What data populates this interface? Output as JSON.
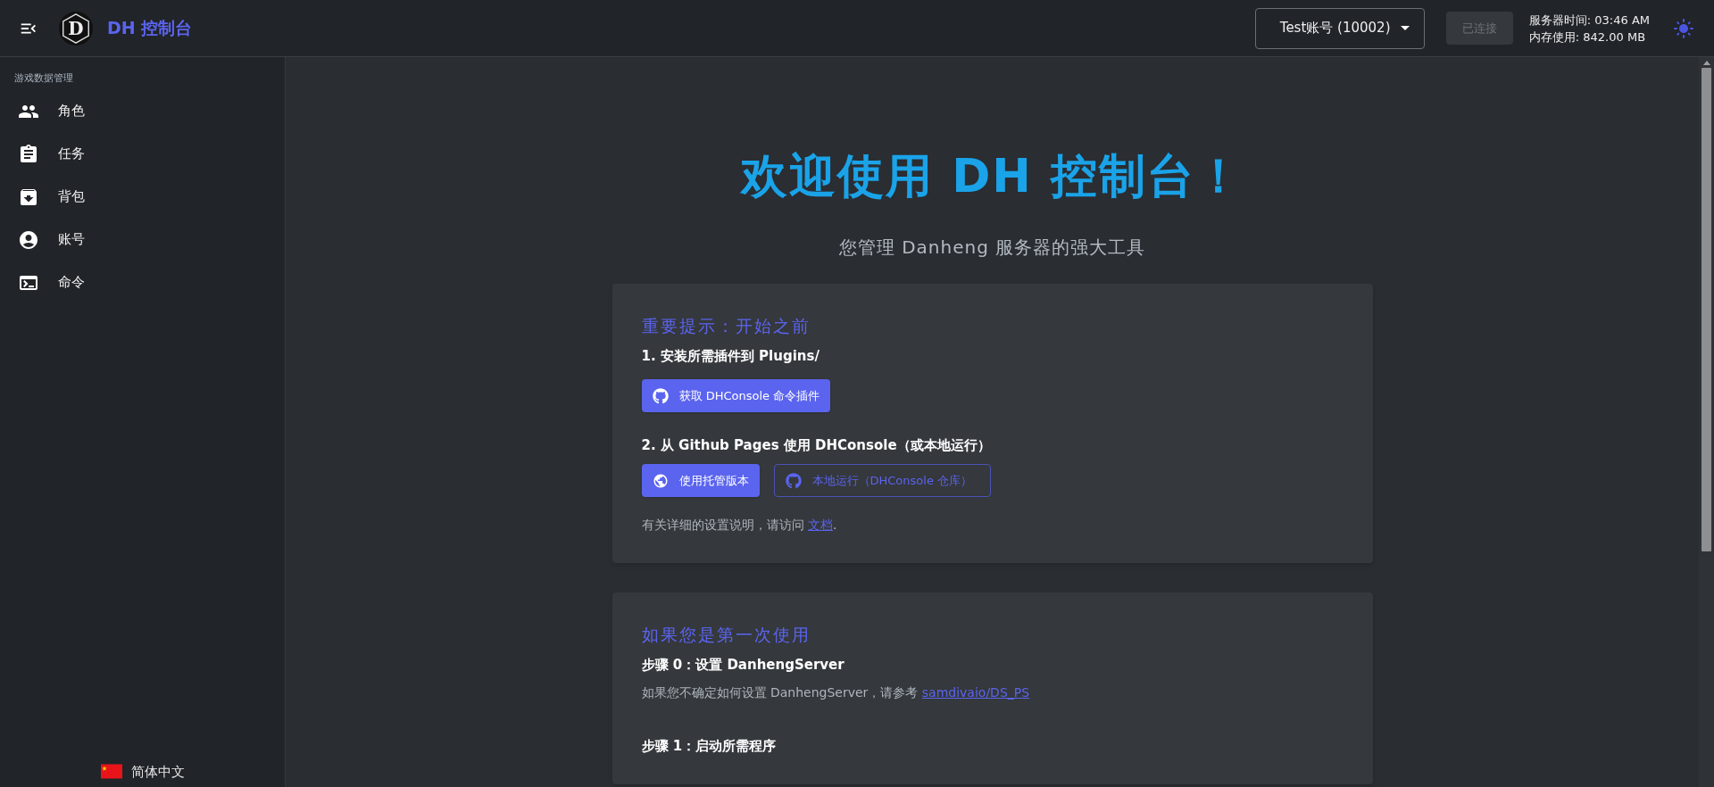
{
  "header": {
    "logo_letter": "D",
    "title": "DH 控制台",
    "account_select": "Test账号 (10002)",
    "connect_button": {
      "label": "已连接",
      "disabled": true
    },
    "server_time": "服务器时间: 03:46 AM",
    "memory": "内存使用: 842.00 MB"
  },
  "sidebar": {
    "section": "游戏数据管理",
    "items": [
      {
        "label": "角色"
      },
      {
        "label": "任务"
      },
      {
        "label": "背包"
      },
      {
        "label": "账号"
      },
      {
        "label": "命令"
      }
    ],
    "language": "简体中文"
  },
  "main": {
    "title": "欢迎使用 DH 控制台！",
    "subtitle": "您管理 Danheng 服务器的强大工具",
    "cards": [
      {
        "heading": "重要提示：开始之前",
        "blocks": [
          {
            "kind": "step",
            "text": "1. 安装所需插件到 Plugins/"
          },
          {
            "kind": "buttons",
            "buttons": [
              {
                "label": "获取 DHConsole 命令插件",
                "kind": "filled"
              }
            ]
          },
          {
            "kind": "step",
            "text": "2. 从 Github Pages 使用 DHConsole（或本地运行）"
          },
          {
            "kind": "buttons",
            "buttons": [
              {
                "label": "使用托管版本",
                "kind": "filled"
              },
              {
                "label": "本地运行（DHConsole 仓库）",
                "kind": "outlined"
              }
            ]
          },
          {
            "kind": "note",
            "text": "有关详细的设置说明，请访问 ",
            "link": "文档",
            "suffix": "."
          }
        ]
      },
      {
        "heading": "如果您是第一次使用",
        "blocks": [
          {
            "kind": "step",
            "text": "步骤 0：设置 DanhengServer"
          },
          {
            "kind": "note",
            "text": "如果您不确定如何设置 DanhengServer，请参考 ",
            "link": "samdivaio/DS_PS"
          },
          {
            "kind": "step",
            "text": "步骤 1：启动所需程序"
          }
        ]
      }
    ]
  }
}
